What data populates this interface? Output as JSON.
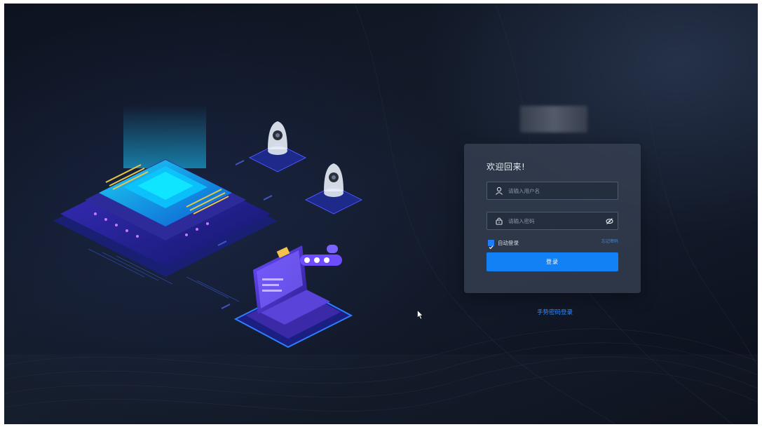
{
  "login": {
    "title": "欢迎回来!",
    "username": {
      "placeholder": "请输入用户名",
      "icon": "user-icon"
    },
    "password": {
      "placeholder": "请输入密码",
      "icon": "lock-icon",
      "toggle_icon": "eye-off-icon"
    },
    "remember": {
      "label": "自动登录",
      "checked": true
    },
    "forgot_label": "忘记密码",
    "submit_label": "登录"
  },
  "alt_login_label": "手势密码登录",
  "colors": {
    "accent": "#1181f5",
    "link": "#2f8cff",
    "background": "#111827",
    "card": "#3a4456"
  },
  "illustration": {
    "icons": [
      "chip-icon",
      "camera-icon",
      "camera-icon",
      "laptop-icon"
    ]
  }
}
